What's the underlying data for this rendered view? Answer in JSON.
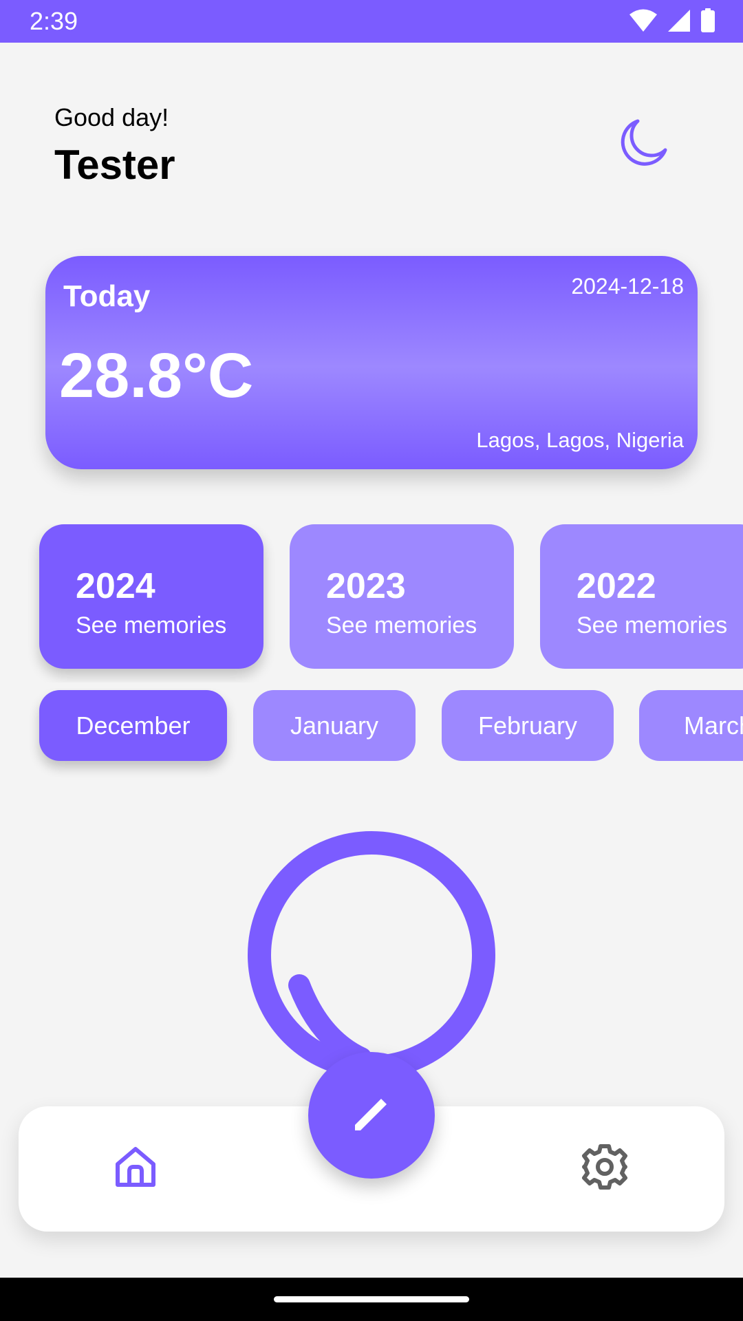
{
  "colors": {
    "primary": "#7b5cff",
    "primary_light": "#9d88ff",
    "background": "#f4f4f4",
    "icon_gray": "#616161"
  },
  "status_bar": {
    "time": "2:39",
    "icons": [
      "wifi-icon",
      "signal-icon",
      "battery-icon"
    ]
  },
  "header": {
    "greeting": "Good day!",
    "username": "Tester",
    "theme_icon": "moon-icon"
  },
  "weather": {
    "label": "Today",
    "date": "2024-12-18",
    "temperature": "28.8°C",
    "location": "Lagos, Lagos, Nigeria"
  },
  "years": [
    {
      "year": "2024",
      "subtitle": "See memories",
      "active": true
    },
    {
      "year": "2023",
      "subtitle": "See memories",
      "active": false
    },
    {
      "year": "2022",
      "subtitle": "See memories",
      "active": false
    }
  ],
  "months": [
    {
      "label": "December",
      "active": true
    },
    {
      "label": "January",
      "active": false
    },
    {
      "label": "February",
      "active": false
    },
    {
      "label": "March",
      "active": false
    }
  ],
  "bottom_nav": {
    "home_icon": "home-icon",
    "settings_icon": "settings-icon",
    "fab_icon": "pencil-icon"
  }
}
